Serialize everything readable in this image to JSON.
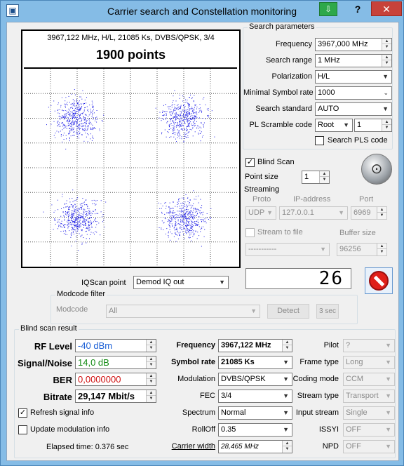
{
  "window": {
    "title": "Carrier search and Constellation monitoring",
    "app_icon": "app-logo-icon",
    "pin_icon": "pin-icon",
    "help": "?",
    "close": "✕"
  },
  "plot": {
    "info": "3967,122 MHz, H/L, 21085 Ks, DVBS/QPSK, 3/4",
    "points_label": "1900 points",
    "point_color": "#1a1ae6"
  },
  "search": {
    "group_title": "Search parameters",
    "frequency_label": "Frequency",
    "frequency_value": "3967,000 MHz",
    "range_label": "Search range",
    "range_value": "1 MHz",
    "polarization_label": "Polarization",
    "polarization_value": "H/L",
    "min_symbol_label": "Minimal Symbol rate",
    "min_symbol_value": "1000",
    "standard_label": "Search standard",
    "standard_value": "AUTO",
    "pl_label": "PL Scramble code",
    "pl_value": "Root",
    "pl_number": "1",
    "pls_label": "Search PLS code"
  },
  "blind": {
    "checkbox_label": "Blind Scan",
    "checked": true,
    "point_size_label": "Point size",
    "point_size_value": "1",
    "logo_icon": "satellite-dish-icon"
  },
  "streaming": {
    "title": "Streaming",
    "proto_label": "Proto",
    "ip_label": "IP-address",
    "port_label": "Port",
    "proto_value": "UDP",
    "ip_value": "127.0.0.1",
    "port_value": "6969",
    "stream_to_file_label": "Stream to file",
    "buffer_label": "Buffer size",
    "file_value": "-----------",
    "buffer_value": "96256"
  },
  "counter": {
    "value": "26",
    "stop_icon": "stop-icon"
  },
  "iqscan": {
    "label": "IQScan point",
    "value": "Demod IQ out"
  },
  "modcode": {
    "group_title": "Modcode filter",
    "label": "Modcode",
    "value": "All",
    "detect": "Detect",
    "interval": "3 sec"
  },
  "result": {
    "group_title": "Blind scan result",
    "rf_label": "RF Level",
    "rf_value": "-40 dBm",
    "rf_color": "#1a5fd6",
    "snr_label": "Signal/Noise",
    "snr_value": "14,0 dB",
    "snr_color": "#138a13",
    "ber_label": "BER",
    "ber_value": "0,0000000",
    "ber_color": "#d01010",
    "bitrate_label": "Bitrate",
    "bitrate_value": "29,147 Mbit/s",
    "refresh_label": "Refresh signal info",
    "refresh_checked": true,
    "update_label": "Update modulation info",
    "update_checked": false,
    "elapsed": "Elapsed time: 0.376 sec",
    "freq_label": "Frequency",
    "freq_value": "3967,122 MHz",
    "sr_label": "Symbol rate",
    "sr_value": "21085 Ks",
    "mod_label": "Modulation",
    "mod_value": "DVBS/QPSK",
    "fec_label": "FEC",
    "fec_value": "3/4",
    "spectrum_label": "Spectrum",
    "spectrum_value": "Normal",
    "rolloff_label": "RollOff",
    "rolloff_value": "0.35",
    "cw_label": "Carrier width",
    "cw_value": "28,465 MHz",
    "pilot_label": "Pilot",
    "pilot_value": "?",
    "frame_label": "Frame type",
    "frame_value": "Long",
    "coding_label": "Coding mode",
    "coding_value": "CCM",
    "stype_label": "Stream type",
    "stype_value": "Transport",
    "istream_label": "Input stream",
    "istream_value": "Single",
    "issyi_label": "ISSYI",
    "issyi_value": "OFF",
    "npd_label": "NPD",
    "npd_value": "OFF"
  }
}
